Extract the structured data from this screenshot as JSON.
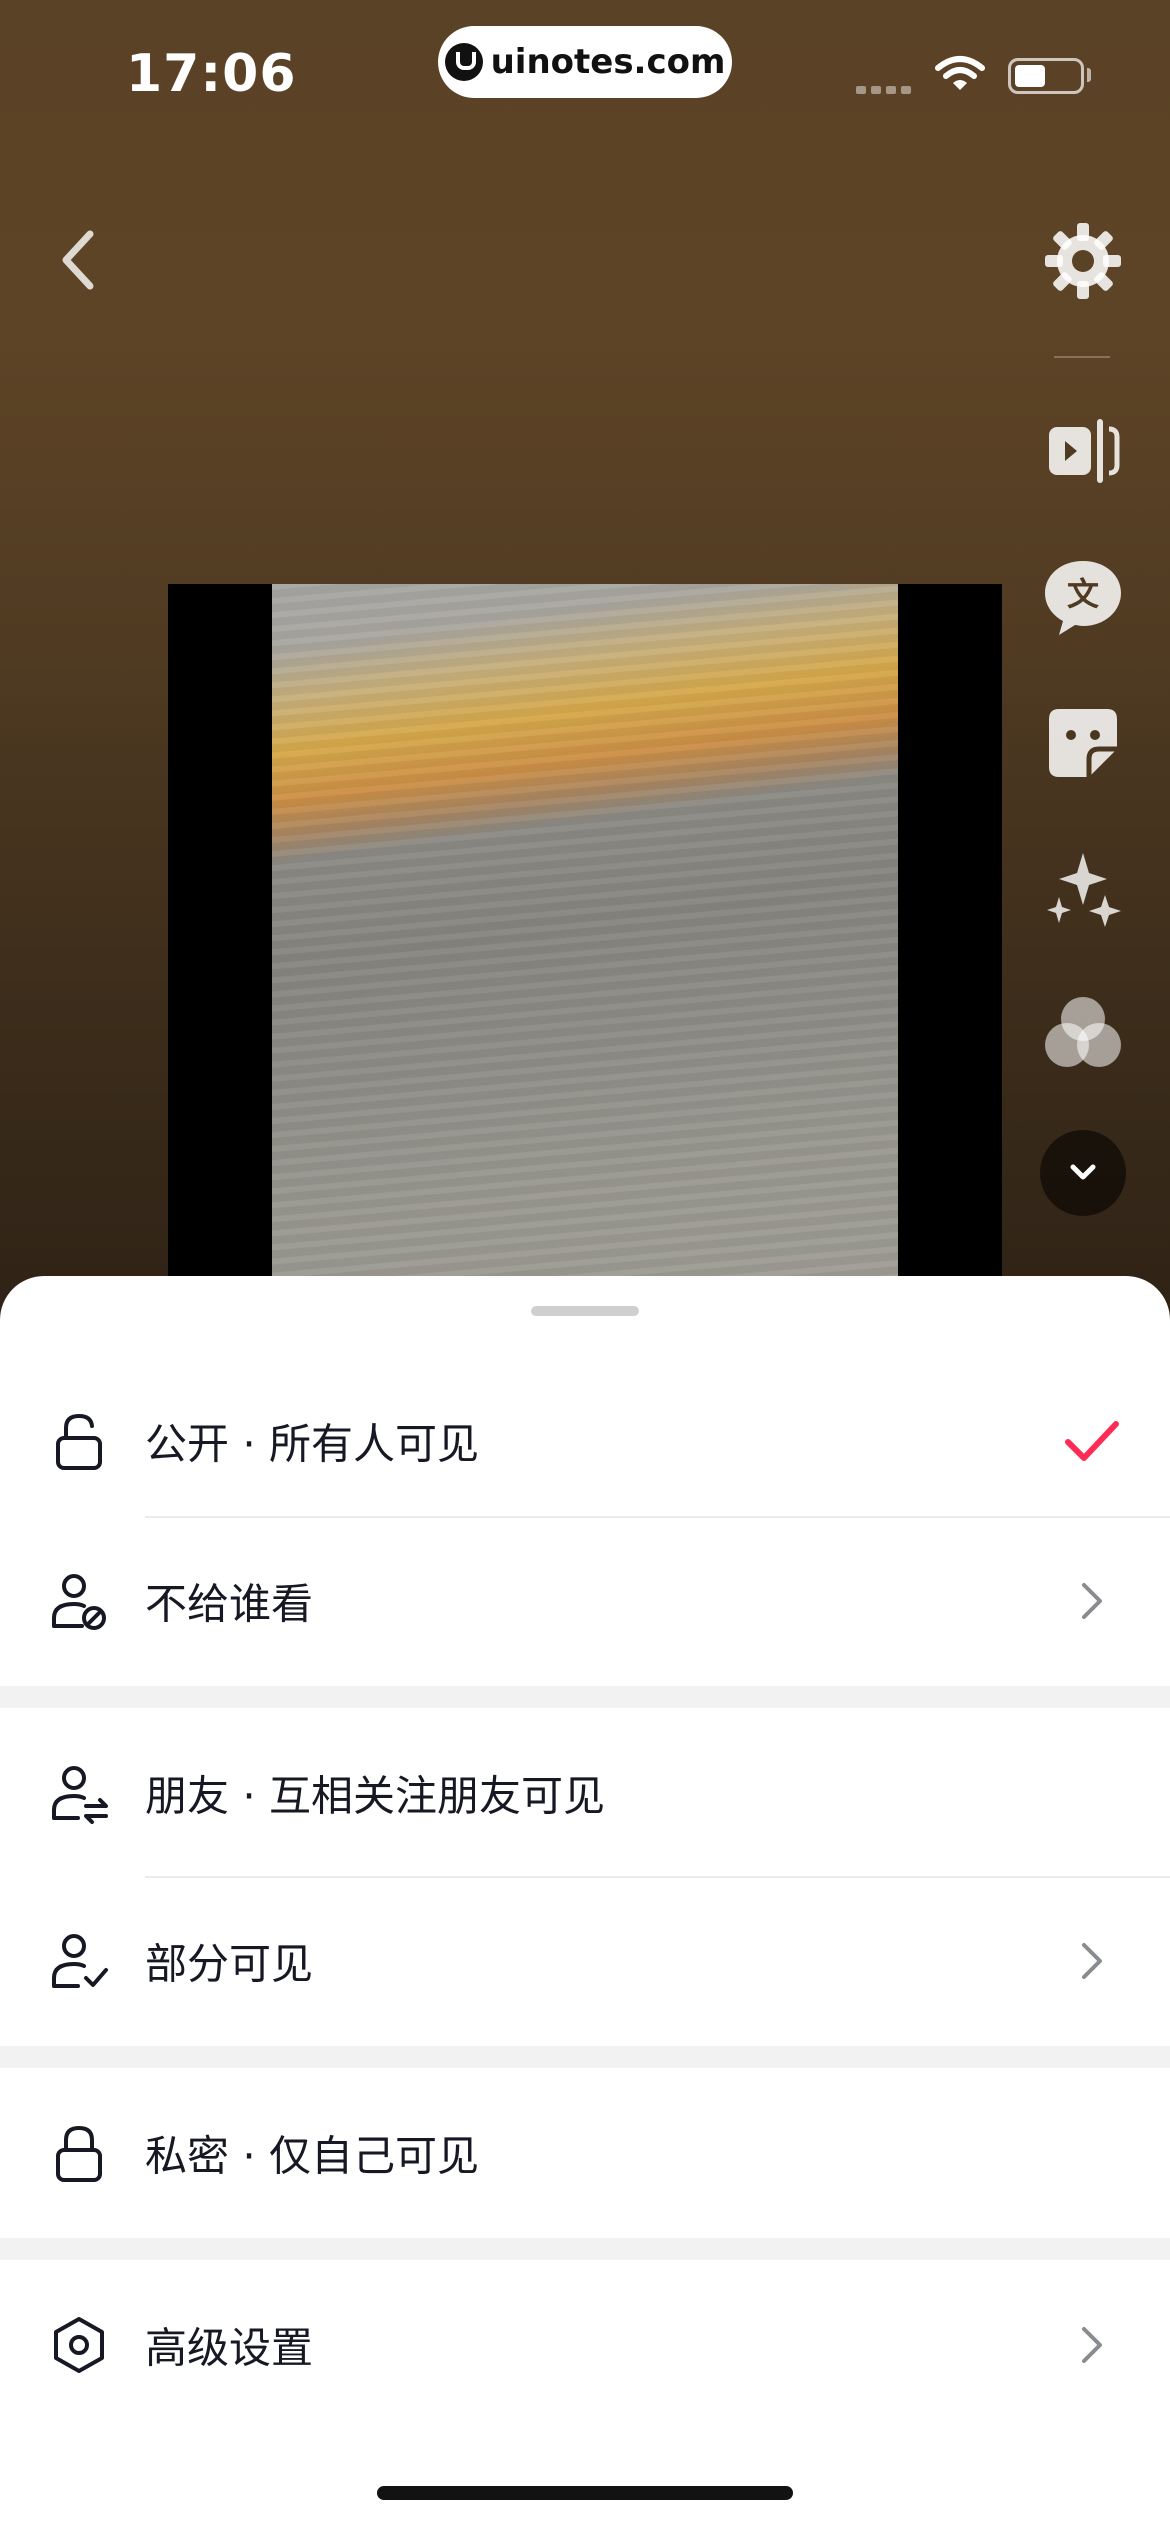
{
  "status_bar": {
    "time": "17:06",
    "url": "uinotes.com"
  },
  "toolbar": {
    "icons": [
      "settings-icon",
      "split-icon",
      "translate-icon",
      "sticker-icon",
      "effects-icon",
      "filter-icon",
      "chevron-down-icon"
    ],
    "translate_glyph": "文"
  },
  "sheet": {
    "options": [
      {
        "label": "公开 · 所有人可见",
        "icon": "unlock-icon",
        "selected": true
      },
      {
        "label": "不给谁看",
        "icon": "user-block-icon",
        "chevron": true
      },
      {
        "label": "朋友 · 互相关注朋友可见",
        "icon": "user-swap-icon"
      },
      {
        "label": "部分可见",
        "icon": "user-check-icon",
        "chevron": true
      },
      {
        "label": "私密 · 仅自己可见",
        "icon": "lock-icon"
      },
      {
        "label": "高级设置",
        "icon": "hexagon-settings-icon",
        "chevron": true
      }
    ],
    "accent_color": "#fe2c55"
  }
}
